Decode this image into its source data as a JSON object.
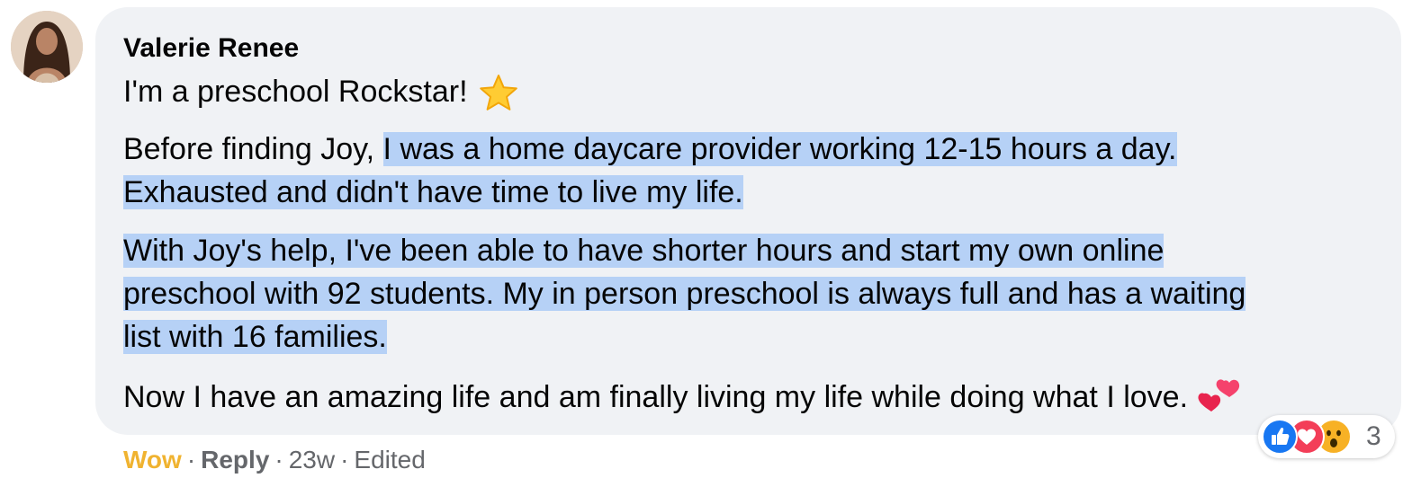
{
  "comment": {
    "author": "Valerie Renee",
    "line1": "I'm a preschool Rockstar!",
    "line1_emoji": "star-icon",
    "para2": {
      "line1_plain": "Before finding Joy, ",
      "line1_hl": "I was a home daycare provider working 12-15 hours a day. ",
      "line2_hl": "Exhausted and didn't have time to live my life. "
    },
    "para3": {
      "line1": "With Joy's help, I've been able to have shorter hours and start my own online ",
      "line2": "preschool with 92 students. My in person preschool is always full and has a waiting ",
      "line3": "list with 16 families."
    },
    "para4": "Now I have an amazing life and am finally living my life while doing what I love.",
    "para4_emoji": "two-hearts-icon"
  },
  "reactions": {
    "icons": [
      "like-reaction-icon",
      "love-reaction-icon",
      "wow-reaction-icon"
    ],
    "count": "3"
  },
  "meta": {
    "reaction_label": "Wow",
    "reply_label": "Reply",
    "time": "23w",
    "edited": "Edited",
    "separator": "·"
  },
  "colors": {
    "bubble": "#f0f2f5",
    "highlight": "#b6d1f6",
    "wow_label": "#f0b330",
    "muted": "#65676b"
  }
}
